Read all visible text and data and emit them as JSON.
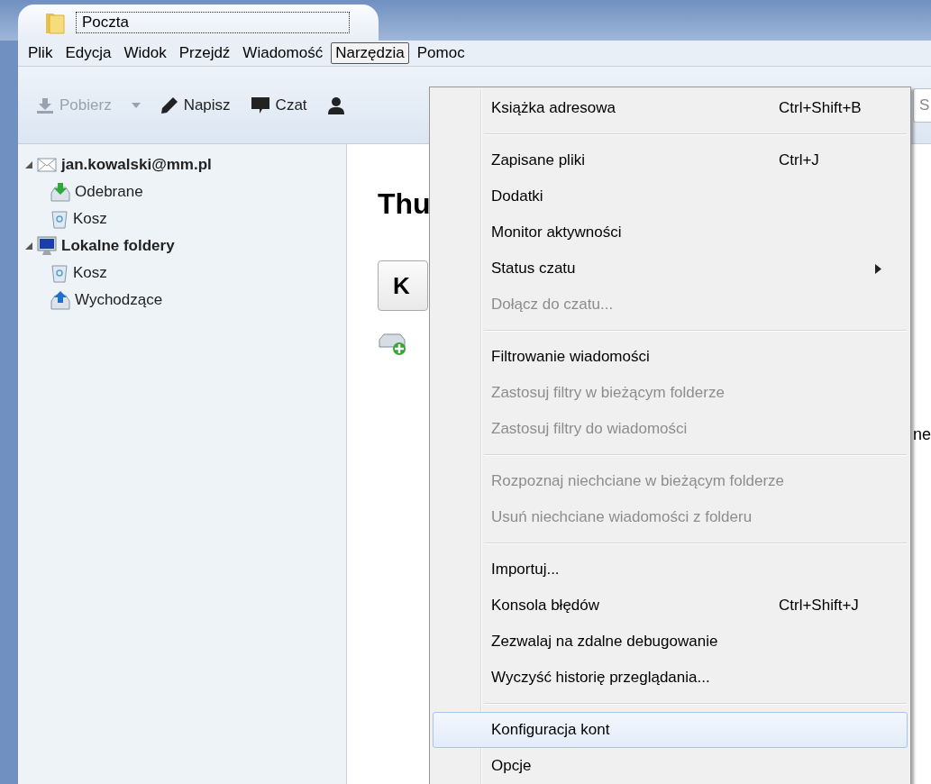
{
  "tab": {
    "title": "Poczta"
  },
  "menubar": {
    "items": [
      {
        "label": "Plik",
        "selected": false
      },
      {
        "label": "Edycja",
        "selected": false
      },
      {
        "label": "Widok",
        "selected": false
      },
      {
        "label": "Przejdź",
        "selected": false
      },
      {
        "label": "Wiadomość",
        "selected": false
      },
      {
        "label": "Narzędzia",
        "selected": true
      },
      {
        "label": "Pomoc",
        "selected": false
      }
    ]
  },
  "toolbar": {
    "buttons": [
      {
        "kind": "download",
        "label": "Pobierz",
        "disabled": true
      },
      {
        "kind": "dropdown",
        "disabled": true
      },
      {
        "kind": "write",
        "label": "Napisz",
        "disabled": false
      },
      {
        "kind": "chat",
        "label": "Czat",
        "disabled": false
      },
      {
        "kind": "contacts",
        "disabled": false
      }
    ],
    "search": {
      "placeholder": "S"
    }
  },
  "sidebar": {
    "accounts": [
      {
        "kind": "mail",
        "name": "jan.kowalski@mm.pl",
        "expanded": true,
        "children": [
          {
            "kind": "inbox",
            "name": "Odebrane"
          },
          {
            "kind": "trash",
            "name": "Kosz"
          }
        ]
      },
      {
        "kind": "local",
        "name": "Lokalne foldery",
        "expanded": true,
        "children": [
          {
            "kind": "trash",
            "name": "Kosz"
          },
          {
            "kind": "outbox",
            "name": "Wychodzące"
          }
        ]
      }
    ]
  },
  "content": {
    "heading": "Thu",
    "button": "K",
    "side_text": "ne"
  },
  "menu": {
    "items": [
      {
        "kind": "item",
        "label": "Książka adresowa",
        "shortcut": "Ctrl+Shift+B",
        "disabled": false,
        "selected": false
      },
      {
        "kind": "separator"
      },
      {
        "kind": "item",
        "label": "Zapisane pliki",
        "shortcut": "Ctrl+J",
        "disabled": false,
        "selected": false
      },
      {
        "kind": "item",
        "label": "Dodatki",
        "disabled": false,
        "selected": false
      },
      {
        "kind": "item",
        "label": "Monitor aktywności",
        "disabled": false,
        "selected": false
      },
      {
        "kind": "item",
        "label": "Status czatu",
        "submenu": true,
        "disabled": false,
        "selected": false
      },
      {
        "kind": "item",
        "label": "Dołącz do czatu...",
        "disabled": true,
        "selected": false
      },
      {
        "kind": "separator"
      },
      {
        "kind": "item",
        "label": "Filtrowanie wiadomości",
        "disabled": false,
        "selected": false
      },
      {
        "kind": "item",
        "label": "Zastosuj filtry w bieżącym folderze",
        "disabled": true,
        "selected": false
      },
      {
        "kind": "item",
        "label": "Zastosuj filtry do wiadomości",
        "disabled": true,
        "selected": false
      },
      {
        "kind": "separator"
      },
      {
        "kind": "item",
        "label": "Rozpoznaj niechciane w bieżącym folderze",
        "disabled": true,
        "selected": false
      },
      {
        "kind": "item",
        "label": "Usuń niechciane wiadomości z folderu",
        "disabled": true,
        "selected": false
      },
      {
        "kind": "separator"
      },
      {
        "kind": "item",
        "label": "Importuj...",
        "disabled": false,
        "selected": false
      },
      {
        "kind": "item",
        "label": "Konsola błędów",
        "shortcut": "Ctrl+Shift+J",
        "disabled": false,
        "selected": false
      },
      {
        "kind": "item",
        "label": "Zezwalaj na zdalne debugowanie",
        "disabled": false,
        "selected": false
      },
      {
        "kind": "item",
        "label": "Wyczyść historię przeglądania...",
        "disabled": false,
        "selected": false
      },
      {
        "kind": "separator"
      },
      {
        "kind": "item",
        "label": "Konfiguracja kont",
        "disabled": false,
        "selected": true
      },
      {
        "kind": "item",
        "label": "Opcje",
        "disabled": false,
        "selected": false
      }
    ]
  }
}
